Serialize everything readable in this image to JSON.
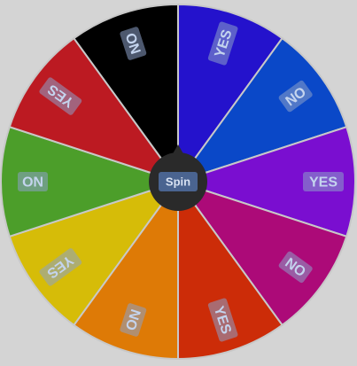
{
  "wheel": {
    "spin_label": "Spin",
    "segments": [
      {
        "label": "YES",
        "color": "#2412cc"
      },
      {
        "label": "NO",
        "color": "#0a48c8"
      },
      {
        "label": "YES",
        "color": "#7a0ed0"
      },
      {
        "label": "NO",
        "color": "#ac0a78"
      },
      {
        "label": "YES",
        "color": "#cc2c08"
      },
      {
        "label": "NO",
        "color": "#de7a06"
      },
      {
        "label": "YES",
        "color": "#d6bc08"
      },
      {
        "label": "NO",
        "color": "#4c9e2a"
      },
      {
        "label": "YES",
        "color": "#bc1a22"
      },
      {
        "label": "NO",
        "color": "#000000"
      }
    ],
    "colors": {
      "background": "#d4d4d4",
      "divider": "#c8c8c8",
      "hub": "#2a2a2a",
      "spin_button_bg": "#4a6490"
    }
  }
}
